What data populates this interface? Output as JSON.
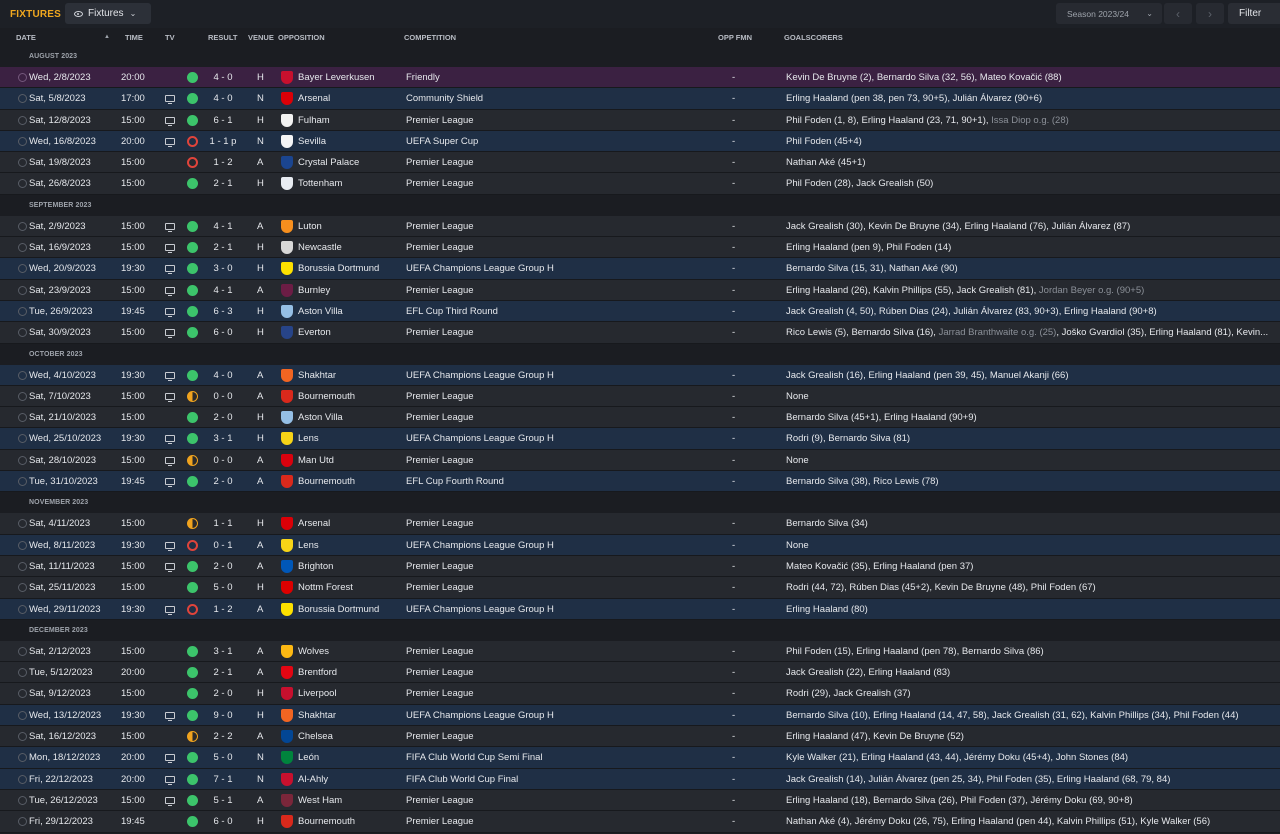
{
  "header": {
    "title": "FIXTURES",
    "view_dropdown": "Fixtures",
    "season_dropdown": "Season 2023/24",
    "filter_label": "Filter"
  },
  "columns": {
    "date": "DATE",
    "time": "TIME",
    "tv": "TV",
    "result": "RESULT",
    "venue": "VENUE",
    "opposition": "OPPOSITION",
    "competition": "COMPETITION",
    "opp_fmn": "OPP FMN",
    "goalscorers": "GOALSCORERS"
  },
  "colors": {
    "win": "#3cc46b",
    "loss": "#e0443b",
    "draw": "#f0a31e",
    "accent": "#f1a81f"
  },
  "months": [
    {
      "label": "AUGUST 2023",
      "rows": [
        {
          "date": "Wed, 2/8/2023",
          "time": "20:00",
          "tv": false,
          "result": "W",
          "score": "4 - 0",
          "venue": "H",
          "opposition": "Bayer Leverkusen",
          "crest": "#c8102e",
          "competition": "Friendly",
          "opp_fmn": "-",
          "goalscorers": "Kevin De Bruyne (2), Bernardo Silva (32, 56), Mateo Kovačić (88)",
          "style": "first"
        },
        {
          "date": "Sat, 5/8/2023",
          "time": "17:00",
          "tv": true,
          "result": "W",
          "score": "4 - 0",
          "venue": "N",
          "opposition": "Arsenal",
          "crest": "#db0007",
          "competition": "Community Shield",
          "opp_fmn": "-",
          "goalscorers": "Erling Haaland (pen 38, pen 73, 90+5), Julián Álvarez (90+6)",
          "style": "alt"
        },
        {
          "date": "Sat, 12/8/2023",
          "time": "15:00",
          "tv": true,
          "result": "W",
          "score": "6 - 1",
          "venue": "H",
          "opposition": "Fulham",
          "crest": "#f2f2f2",
          "competition": "Premier League",
          "opp_fmn": "-",
          "goalscorers": "Phil Foden (1, 8), Erling Haaland (23, 71, 90+1), ",
          "og": "Issa Diop o.g. (28)",
          "style": ""
        },
        {
          "date": "Wed, 16/8/2023",
          "time": "20:00",
          "tv": true,
          "result": "L",
          "score": "1 - 1 p",
          "venue": "N",
          "opposition": "Sevilla",
          "crest": "#f5f5f5",
          "competition": "UEFA Super Cup",
          "opp_fmn": "-",
          "goalscorers": "Phil Foden (45+4)",
          "style": "alt"
        },
        {
          "date": "Sat, 19/8/2023",
          "time": "15:00",
          "tv": false,
          "result": "L",
          "score": "1 - 2",
          "venue": "A",
          "opposition": "Crystal Palace",
          "crest": "#1b458f",
          "competition": "Premier League",
          "opp_fmn": "-",
          "goalscorers": "Nathan Aké (45+1)",
          "style": ""
        },
        {
          "date": "Sat, 26/8/2023",
          "time": "15:00",
          "tv": false,
          "result": "W",
          "score": "2 - 1",
          "venue": "H",
          "opposition": "Tottenham",
          "crest": "#e8ecf2",
          "competition": "Premier League",
          "opp_fmn": "-",
          "goalscorers": "Phil Foden (28), Jack Grealish (50)",
          "style": ""
        }
      ]
    },
    {
      "label": "SEPTEMBER 2023",
      "rows": [
        {
          "date": "Sat, 2/9/2023",
          "time": "15:00",
          "tv": true,
          "result": "W",
          "score": "4 - 1",
          "venue": "A",
          "opposition": "Luton",
          "crest": "#f78f1e",
          "competition": "Premier League",
          "opp_fmn": "-",
          "goalscorers": "Jack Grealish (30), Kevin De Bruyne (34), Erling Haaland (76), Julián Álvarez (87)",
          "style": ""
        },
        {
          "date": "Sat, 16/9/2023",
          "time": "15:00",
          "tv": true,
          "result": "W",
          "score": "2 - 1",
          "venue": "H",
          "opposition": "Newcastle",
          "crest": "#d8d8d8",
          "competition": "Premier League",
          "opp_fmn": "-",
          "goalscorers": "Erling Haaland (pen 9), Phil Foden (14)",
          "style": ""
        },
        {
          "date": "Wed, 20/9/2023",
          "time": "19:30",
          "tv": true,
          "result": "W",
          "score": "3 - 0",
          "venue": "H",
          "opposition": "Borussia Dortmund",
          "crest": "#fde100",
          "competition": "UEFA Champions League Group H",
          "opp_fmn": "-",
          "goalscorers": "Bernardo Silva (15, 31), Nathan Aké (90)",
          "style": "alt"
        },
        {
          "date": "Sat, 23/9/2023",
          "time": "15:00",
          "tv": true,
          "result": "W",
          "score": "4 - 1",
          "venue": "A",
          "opposition": "Burnley",
          "crest": "#6c1d45",
          "competition": "Premier League",
          "opp_fmn": "-",
          "goalscorers": "Erling Haaland (26), Kalvin Phillips (55), Jack Grealish (81), ",
          "og": "Jordan Beyer o.g. (90+5)",
          "style": ""
        },
        {
          "date": "Tue, 26/9/2023",
          "time": "19:45",
          "tv": true,
          "result": "W",
          "score": "6 - 3",
          "venue": "H",
          "opposition": "Aston Villa",
          "crest": "#95bfe5",
          "competition": "EFL Cup Third Round",
          "opp_fmn": "-",
          "goalscorers": "Jack Grealish (4, 50), Rúben Dias (24), Julián Álvarez (83, 90+3), Erling Haaland (90+8)",
          "style": "alt"
        },
        {
          "date": "Sat, 30/9/2023",
          "time": "15:00",
          "tv": true,
          "result": "W",
          "score": "6 - 0",
          "venue": "H",
          "opposition": "Everton",
          "crest": "#274488",
          "competition": "Premier League",
          "opp_fmn": "-",
          "goalscorers": "Rico Lewis (5), Bernardo Silva (16), ",
          "og": "Jarrad Branthwaite o.g. (25)",
          "goalscorers_after": ", Joško Gvardiol (35), Erling Haaland (81), Kevin...",
          "style": ""
        }
      ]
    },
    {
      "label": "OCTOBER 2023",
      "rows": [
        {
          "date": "Wed, 4/10/2023",
          "time": "19:30",
          "tv": true,
          "result": "W",
          "score": "4 - 0",
          "venue": "A",
          "opposition": "Shakhtar",
          "crest": "#f26522",
          "competition": "UEFA Champions League Group H",
          "opp_fmn": "-",
          "goalscorers": "Jack Grealish (16), Erling Haaland (pen 39, 45), Manuel Akanji (66)",
          "style": "alt"
        },
        {
          "date": "Sat, 7/10/2023",
          "time": "15:00",
          "tv": true,
          "result": "D",
          "score": "0 - 0",
          "venue": "A",
          "opposition": "Bournemouth",
          "crest": "#da291c",
          "competition": "Premier League",
          "opp_fmn": "-",
          "goalscorers": "None",
          "style": ""
        },
        {
          "date": "Sat, 21/10/2023",
          "time": "15:00",
          "tv": false,
          "result": "W",
          "score": "2 - 0",
          "venue": "H",
          "opposition": "Aston Villa",
          "crest": "#95bfe5",
          "competition": "Premier League",
          "opp_fmn": "-",
          "goalscorers": "Bernardo Silva (45+1), Erling Haaland (90+9)",
          "style": ""
        },
        {
          "date": "Wed, 25/10/2023",
          "time": "19:30",
          "tv": true,
          "result": "W",
          "score": "3 - 1",
          "venue": "H",
          "opposition": "Lens",
          "crest": "#f7d417",
          "competition": "UEFA Champions League Group H",
          "opp_fmn": "-",
          "goalscorers": "Rodri (9), Bernardo Silva (81)",
          "style": "alt"
        },
        {
          "date": "Sat, 28/10/2023",
          "time": "15:00",
          "tv": true,
          "result": "D",
          "score": "0 - 0",
          "venue": "A",
          "opposition": "Man Utd",
          "crest": "#da020e",
          "competition": "Premier League",
          "opp_fmn": "-",
          "goalscorers": "None",
          "style": ""
        },
        {
          "date": "Tue, 31/10/2023",
          "time": "19:45",
          "tv": true,
          "result": "W",
          "score": "2 - 0",
          "venue": "A",
          "opposition": "Bournemouth",
          "crest": "#da291c",
          "competition": "EFL Cup Fourth Round",
          "opp_fmn": "-",
          "goalscorers": "Bernardo Silva (38), Rico Lewis (78)",
          "style": "alt"
        }
      ]
    },
    {
      "label": "NOVEMBER 2023",
      "rows": [
        {
          "date": "Sat, 4/11/2023",
          "time": "15:00",
          "tv": false,
          "result": "D",
          "score": "1 - 1",
          "venue": "H",
          "opposition": "Arsenal",
          "crest": "#db0007",
          "competition": "Premier League",
          "opp_fmn": "-",
          "goalscorers": "Bernardo Silva (34)",
          "style": ""
        },
        {
          "date": "Wed, 8/11/2023",
          "time": "19:30",
          "tv": true,
          "result": "L",
          "score": "0 - 1",
          "venue": "A",
          "opposition": "Lens",
          "crest": "#f7d417",
          "competition": "UEFA Champions League Group H",
          "opp_fmn": "-",
          "goalscorers": "None",
          "style": "alt"
        },
        {
          "date": "Sat, 11/11/2023",
          "time": "15:00",
          "tv": true,
          "result": "W",
          "score": "2 - 0",
          "venue": "A",
          "opposition": "Brighton",
          "crest": "#0057b8",
          "competition": "Premier League",
          "opp_fmn": "-",
          "goalscorers": "Mateo Kovačić (35), Erling Haaland (pen 37)",
          "style": ""
        },
        {
          "date": "Sat, 25/11/2023",
          "time": "15:00",
          "tv": false,
          "result": "W",
          "score": "5 - 0",
          "venue": "H",
          "opposition": "Nottm Forest",
          "crest": "#dd0000",
          "competition": "Premier League",
          "opp_fmn": "-",
          "goalscorers": "Rodri (44, 72), Rúben Dias (45+2), Kevin De Bruyne (48), Phil Foden (67)",
          "style": ""
        },
        {
          "date": "Wed, 29/11/2023",
          "time": "19:30",
          "tv": true,
          "result": "L",
          "score": "1 - 2",
          "venue": "A",
          "opposition": "Borussia Dortmund",
          "crest": "#fde100",
          "competition": "UEFA Champions League Group H",
          "opp_fmn": "-",
          "goalscorers": "Erling Haaland (80)",
          "style": "alt"
        }
      ]
    },
    {
      "label": "DECEMBER 2023",
      "rows": [
        {
          "date": "Sat, 2/12/2023",
          "time": "15:00",
          "tv": false,
          "result": "W",
          "score": "3 - 1",
          "venue": "A",
          "opposition": "Wolves",
          "crest": "#fdb913",
          "competition": "Premier League",
          "opp_fmn": "-",
          "goalscorers": "Phil Foden (15), Erling Haaland (pen 78), Bernardo Silva (86)",
          "style": ""
        },
        {
          "date": "Tue, 5/12/2023",
          "time": "20:00",
          "tv": false,
          "result": "W",
          "score": "2 - 1",
          "venue": "A",
          "opposition": "Brentford",
          "crest": "#e30613",
          "competition": "Premier League",
          "opp_fmn": "-",
          "goalscorers": "Jack Grealish (22), Erling Haaland (83)",
          "style": ""
        },
        {
          "date": "Sat, 9/12/2023",
          "time": "15:00",
          "tv": false,
          "result": "W",
          "score": "2 - 0",
          "venue": "H",
          "opposition": "Liverpool",
          "crest": "#c8102e",
          "competition": "Premier League",
          "opp_fmn": "-",
          "goalscorers": "Rodri (29), Jack Grealish (37)",
          "style": ""
        },
        {
          "date": "Wed, 13/12/2023",
          "time": "19:30",
          "tv": true,
          "result": "W",
          "score": "9 - 0",
          "venue": "H",
          "opposition": "Shakhtar",
          "crest": "#f26522",
          "competition": "UEFA Champions League Group H",
          "opp_fmn": "-",
          "goalscorers": "Bernardo Silva (10), Erling Haaland (14, 47, 58), Jack Grealish (31, 62), Kalvin Phillips (34), Phil Foden (44)",
          "style": "alt"
        },
        {
          "date": "Sat, 16/12/2023",
          "time": "15:00",
          "tv": false,
          "result": "D",
          "score": "2 - 2",
          "venue": "A",
          "opposition": "Chelsea",
          "crest": "#034694",
          "competition": "Premier League",
          "opp_fmn": "-",
          "goalscorers": "Erling Haaland (47), Kevin De Bruyne (52)",
          "style": ""
        },
        {
          "date": "Mon, 18/12/2023",
          "time": "20:00",
          "tv": true,
          "result": "W",
          "score": "5 - 0",
          "venue": "N",
          "opposition": "León",
          "crest": "#00843d",
          "competition": "FIFA Club World Cup Semi Final",
          "opp_fmn": "-",
          "goalscorers": "Kyle Walker (21), Erling Haaland (43, 44), Jérémy Doku (45+4), John Stones (84)",
          "style": "alt"
        },
        {
          "date": "Fri, 22/12/2023",
          "time": "20:00",
          "tv": true,
          "result": "W",
          "score": "7 - 1",
          "venue": "N",
          "opposition": "Al-Ahly",
          "crest": "#c8102e",
          "competition": "FIFA Club World Cup Final",
          "opp_fmn": "-",
          "goalscorers": "Jack Grealish (14), Julián Álvarez (pen 25, 34), Phil Foden (35), Erling Haaland (68, 79, 84)",
          "style": "alt"
        },
        {
          "date": "Tue, 26/12/2023",
          "time": "15:00",
          "tv": true,
          "result": "W",
          "score": "5 - 1",
          "venue": "A",
          "opposition": "West Ham",
          "crest": "#7a263a",
          "competition": "Premier League",
          "opp_fmn": "-",
          "goalscorers": "Erling Haaland (18), Bernardo Silva (26), Phil Foden (37), Jérémy Doku (69, 90+8)",
          "style": ""
        },
        {
          "date": "Fri, 29/12/2023",
          "time": "19:45",
          "tv": false,
          "result": "W",
          "score": "6 - 0",
          "venue": "H",
          "opposition": "Bournemouth",
          "crest": "#da291c",
          "competition": "Premier League",
          "opp_fmn": "-",
          "goalscorers": "Nathan Aké (4), Jérémy Doku (26, 75), Erling Haaland (pen 44), Kalvin Phillips (51), Kyle Walker (56)",
          "style": ""
        }
      ]
    }
  ]
}
